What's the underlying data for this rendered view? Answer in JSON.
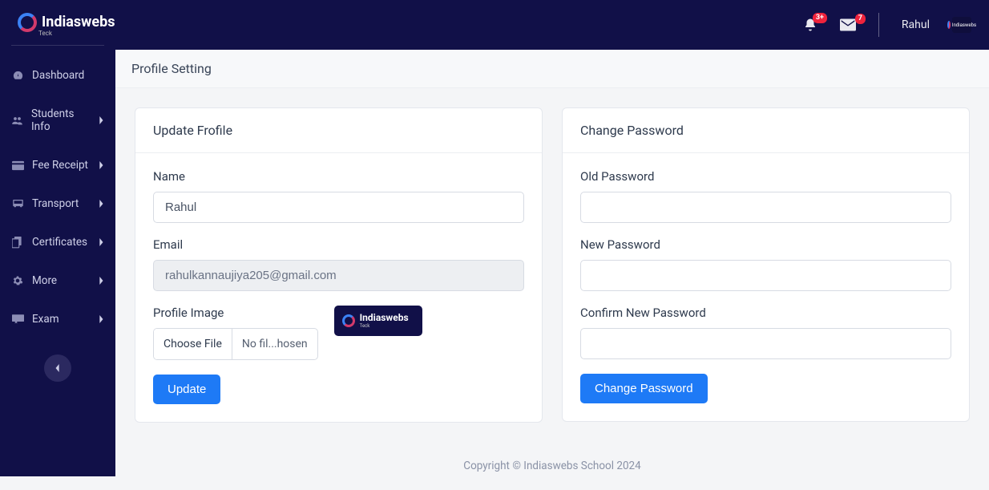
{
  "brand": {
    "name": "Indiaswebs",
    "sub": "Teck"
  },
  "topbar": {
    "notif_badge": "3+",
    "mail_badge": "7",
    "username": "Rahul"
  },
  "sidebar": {
    "items": [
      {
        "label": "Dashboard",
        "has_sub": false
      },
      {
        "label": "Students Info",
        "has_sub": true
      },
      {
        "label": "Fee Receipt",
        "has_sub": true
      },
      {
        "label": "Transport",
        "has_sub": true
      },
      {
        "label": "Certificates",
        "has_sub": true
      },
      {
        "label": "More",
        "has_sub": true
      },
      {
        "label": "Exam",
        "has_sub": true
      }
    ]
  },
  "page": {
    "title": "Profile Setting"
  },
  "profile_card": {
    "title": "Update Frofile",
    "name_label": "Name",
    "name_value": "Rahul",
    "email_label": "Email",
    "email_value": "rahulkannaujiya205@gmail.com",
    "image_label": "Profile Image",
    "file_btn": "Choose File",
    "file_value": "No fil...hosen",
    "submit": "Update"
  },
  "password_card": {
    "title": "Change Password",
    "old_label": "Old Password",
    "new_label": "New Password",
    "confirm_label": "Confirm New Password",
    "submit": "Change Password"
  },
  "footer": {
    "text": "Copyright © Indiaswebs School 2024"
  }
}
